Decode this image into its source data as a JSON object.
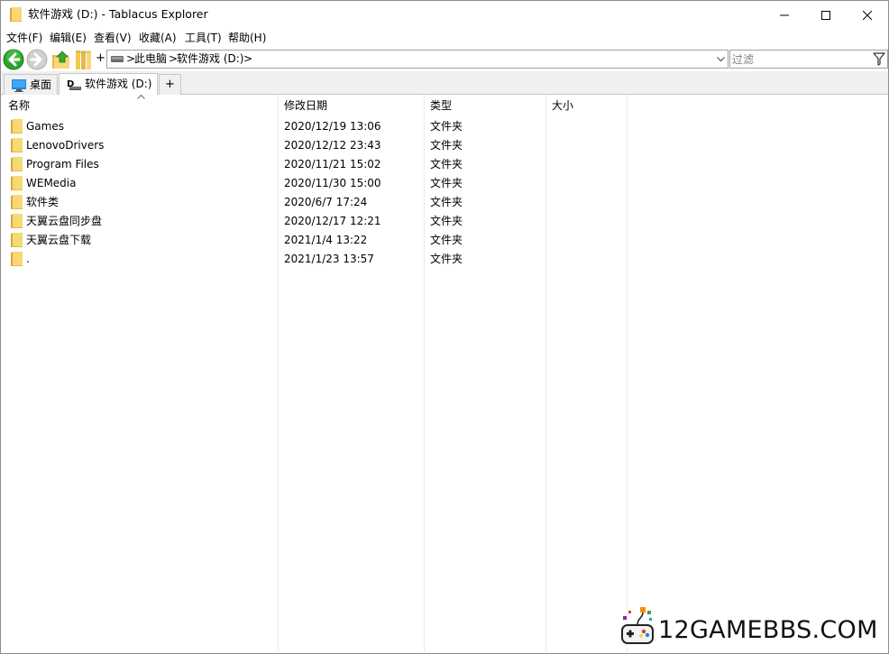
{
  "window": {
    "title": "软件游戏 (D:) - Tablacus Explorer"
  },
  "menu": [
    {
      "label": "文件(F)"
    },
    {
      "label": "编辑(E)"
    },
    {
      "label": "查看(V)"
    },
    {
      "label": "收藏(A)"
    },
    {
      "label": "工具(T)"
    },
    {
      "label": "帮助(H)"
    }
  ],
  "toolbar": {
    "plus": "+",
    "icons": [
      "back-arrow-icon",
      "forward-arrow-icon",
      "up-folder-icon",
      "folder-tree-icon"
    ]
  },
  "address": {
    "segments": [
      {
        "label": "此电脑"
      },
      {
        "label": "软件游戏 (D:)"
      }
    ],
    "separator": ">"
  },
  "filter": {
    "value": "",
    "placeholder": "过滤"
  },
  "tabs": [
    {
      "label": "桌面",
      "active": false,
      "icon": "desktop-icon"
    },
    {
      "label": "软件游戏 (D:)",
      "active": true,
      "icon": "drive-icon"
    }
  ],
  "tab_add_label": "+",
  "columns": [
    {
      "label": "名称"
    },
    {
      "label": "修改日期"
    },
    {
      "label": "类型"
    },
    {
      "label": "大小"
    }
  ],
  "rows": [
    {
      "name": "Games",
      "modified": "2020/12/19 13:06",
      "type": "文件夹",
      "size": ""
    },
    {
      "name": "LenovoDrivers",
      "modified": "2020/12/12 23:43",
      "type": "文件夹",
      "size": ""
    },
    {
      "name": "Program Files",
      "modified": "2020/11/21 15:02",
      "type": "文件夹",
      "size": ""
    },
    {
      "name": "WEMedia",
      "modified": "2020/11/30 15:00",
      "type": "文件夹",
      "size": ""
    },
    {
      "name": "软件类",
      "modified": "2020/6/7 17:24",
      "type": "文件夹",
      "size": ""
    },
    {
      "name": "天翼云盘同步盘",
      "modified": "2020/12/17 12:21",
      "type": "文件夹",
      "size": ""
    },
    {
      "name": "天翼云盘下载",
      "modified": "2021/1/4 13:22",
      "type": "文件夹",
      "size": ""
    },
    {
      "name": ".",
      "modified": "2021/1/23 13:57",
      "type": "文件夹",
      "size": ""
    }
  ],
  "watermark": {
    "text": "12GAMEBBS.COM"
  },
  "colors": {
    "folder": "#f8d775",
    "folder_dark": "#e4b94c",
    "back_green": "#2aa52a",
    "text": "#000000"
  }
}
